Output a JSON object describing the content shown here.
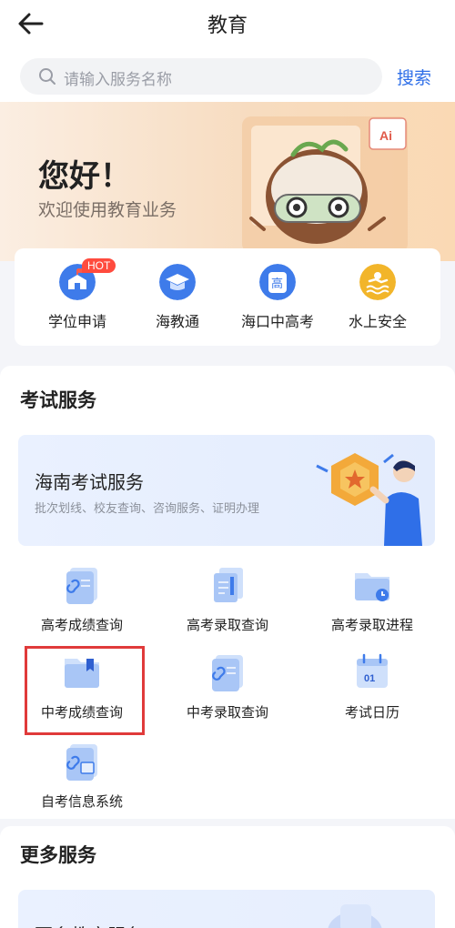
{
  "header": {
    "title": "教育",
    "back_icon": "back-arrow-icon"
  },
  "search": {
    "placeholder": "请输入服务名称",
    "button": "搜索"
  },
  "banner": {
    "greeting": "您好！",
    "welcome": "欢迎使用教育业务",
    "mascot_badge": "Ai"
  },
  "quick_services": [
    {
      "label": "学位申请",
      "icon": "school-icon",
      "badge": "HOT"
    },
    {
      "label": "海教通",
      "icon": "graduation-cap-icon"
    },
    {
      "label": "海口中高考",
      "icon": "gao-badge-icon",
      "icon_text": "高"
    },
    {
      "label": "水上安全",
      "icon": "swimmer-icon"
    }
  ],
  "exam": {
    "section_title": "考试服务",
    "featured": {
      "title": "海南考试服务",
      "subtitle": "批次划线、校友查询、咨询服务、证明办理"
    },
    "items": [
      {
        "label": "高考成绩查询",
        "icon": "score-doc-icon"
      },
      {
        "label": "高考录取查询",
        "icon": "admission-doc-icon"
      },
      {
        "label": "高考录取进程",
        "icon": "folder-clock-icon"
      },
      {
        "label": "中考成绩查询",
        "icon": "folder-bookmark-icon",
        "highlighted": true
      },
      {
        "label": "中考录取查询",
        "icon": "score-doc-icon"
      },
      {
        "label": "考试日历",
        "icon": "calendar-icon",
        "icon_text": "01"
      },
      {
        "label": "自考信息系统",
        "icon": "self-study-doc-icon"
      }
    ]
  },
  "more": {
    "section_title": "更多服务",
    "card_title": "更多教育服务"
  },
  "colors": {
    "accent": "#2f6fe8",
    "hot": "#ff4b3e",
    "highlight": "#e03a3a",
    "icon_blue": "#4f86f0"
  }
}
